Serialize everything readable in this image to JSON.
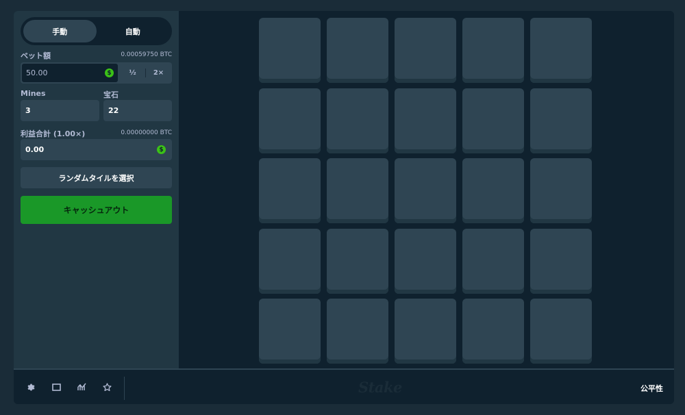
{
  "mode_toggle": {
    "manual": "手動",
    "auto": "自動",
    "active": "manual"
  },
  "bet": {
    "label": "ベット額",
    "btc_value": "0.00059750 BTC",
    "amount": "50.00",
    "currency_icon": "$",
    "half_label": "½",
    "double_label": "2×"
  },
  "mines": {
    "label": "Mines",
    "value": "3"
  },
  "gems": {
    "label": "宝石",
    "value": "22"
  },
  "profit": {
    "label": "利益合計 (1.00×)",
    "btc_value": "0.00000000 BTC",
    "amount": "0.00",
    "currency_icon": "$"
  },
  "buttons": {
    "random_tile": "ランダムタイルを選択",
    "cashout": "キャッシュアウト"
  },
  "grid": {
    "rows": 5,
    "cols": 5
  },
  "footer": {
    "icons": [
      "settings-icon",
      "theatre-mode-icon",
      "live-stats-icon",
      "favorite-icon"
    ],
    "logo": "Stake",
    "fairness": "公平性"
  },
  "colors": {
    "background": "#1a2c38",
    "panel": "#213743",
    "game_bg": "#0f212e",
    "tile": "#2f4553",
    "cashout": "#1a9828",
    "coin": "#3bc117"
  }
}
